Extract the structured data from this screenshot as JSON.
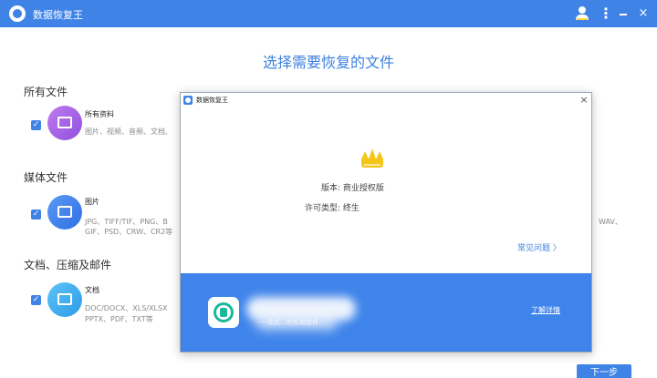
{
  "app": {
    "title": "数据恢复王",
    "accent_color": "#3f83e6",
    "title_bar_icons": [
      "user-icon",
      "more-icon",
      "minimize-icon",
      "close-icon"
    ],
    "minimize_label": "-",
    "close_label": "×",
    "more_label": "⋮"
  },
  "main": {
    "title": "选择需要恢复的文件",
    "sections": [
      {
        "header": "所有文件",
        "checked": true,
        "icon": "monitor-icon",
        "icon_color": "#b063e6",
        "name": "所有资料",
        "desc_line1": "图片、视频、音频、文档,"
      },
      {
        "header": "媒体文件",
        "checked": true,
        "icon": "image-icon",
        "icon_color": "#3d7ff0",
        "name": "图片",
        "desc_line1": "JPG、TIFF/TIF、PNG、B",
        "desc_line2": "GIF、PSD、CRW、CR2等",
        "desc_right": "WAV、"
      },
      {
        "header": "文档、压缩及邮件",
        "checked": true,
        "icon": "document-icon",
        "icon_color": "#38b0f0",
        "name": "文档",
        "desc_line1": "DOC/DOCX、XLS/XLSX",
        "desc_line2": "PPTX、PDF、TXT等"
      }
    ],
    "next_button": "下一步"
  },
  "dialog": {
    "title": "数据恢复王",
    "close_label": "×",
    "crown_icon": "crown-icon",
    "version_label": "版本:",
    "version_value": "商业授权版",
    "license_label": "许可类型:",
    "license_value": "终生",
    "faq_link": "常见问题 〉",
    "promo": {
      "icon": "recovery-app-icon",
      "subtitle": "一站式…的实用软件",
      "details_link": "了解详情",
      "background": "#3f84ea"
    }
  }
}
